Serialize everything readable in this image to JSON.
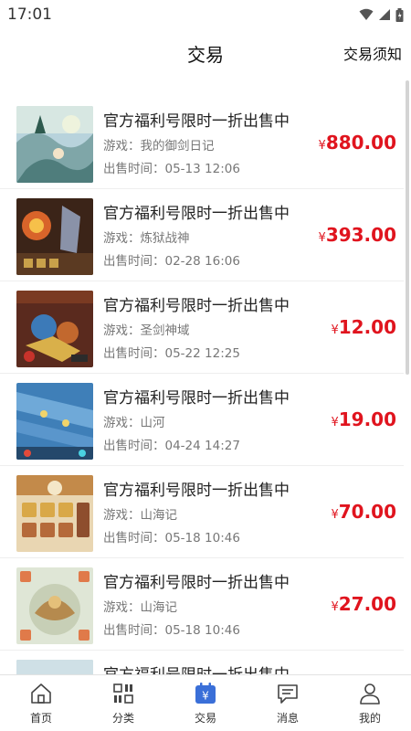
{
  "status": {
    "time": "17:01"
  },
  "header": {
    "title": "交易",
    "notice_link": "交易须知"
  },
  "listings": [
    {
      "title": "官方福利号限时一折出售中",
      "game": "游戏：我的御剑日记",
      "time": "出售时间：05-13 12:06",
      "currency": "¥",
      "price": "880.00",
      "thumb_icon": "game-screenshot"
    },
    {
      "title": "官方福利号限时一折出售中",
      "game": "游戏：炼狱战神",
      "time": "出售时间：02-28 16:06",
      "currency": "¥",
      "price": "393.00",
      "thumb_icon": "game-screenshot"
    },
    {
      "title": "官方福利号限时一折出售中",
      "game": "游戏：圣剑神域",
      "time": "出售时间：05-22 12:25",
      "currency": "¥",
      "price": "12.00",
      "thumb_icon": "game-screenshot"
    },
    {
      "title": "官方福利号限时一折出售中",
      "game": "游戏：山河",
      "time": "出售时间：04-24 14:27",
      "currency": "¥",
      "price": "19.00",
      "thumb_icon": "game-screenshot"
    },
    {
      "title": "官方福利号限时一折出售中",
      "game": "游戏：山海记",
      "time": "出售时间：05-18 10:46",
      "currency": "¥",
      "price": "70.00",
      "thumb_icon": "game-screenshot"
    },
    {
      "title": "官方福利号限时一折出售中",
      "game": "游戏：山海记",
      "time": "出售时间：05-18 10:46",
      "currency": "¥",
      "price": "27.00",
      "thumb_icon": "game-screenshot"
    },
    {
      "title": "官方福利号限时一折出售中",
      "game": "",
      "time": "",
      "currency": "",
      "price": "",
      "thumb_icon": "game-screenshot"
    }
  ],
  "tabs": [
    {
      "label": "首页",
      "icon": "home-icon"
    },
    {
      "label": "分类",
      "icon": "grid-icon"
    },
    {
      "label": "交易",
      "icon": "trade-icon",
      "active": true
    },
    {
      "label": "消息",
      "icon": "message-icon"
    },
    {
      "label": "我的",
      "icon": "user-icon"
    }
  ],
  "colors": {
    "price": "#e0141e",
    "active_tab": "#3a6fd8"
  }
}
